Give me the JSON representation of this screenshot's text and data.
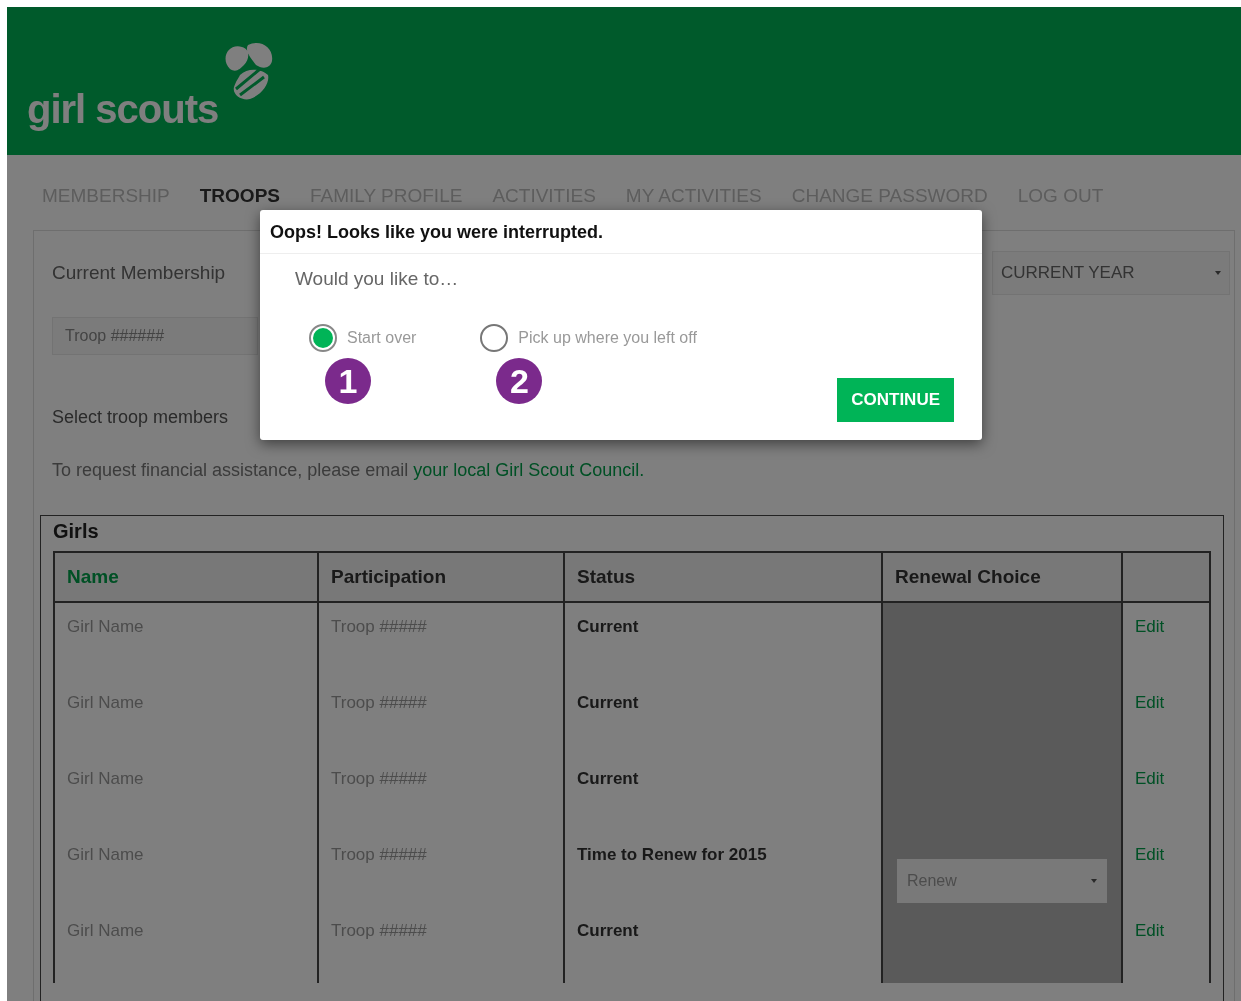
{
  "header": {
    "logo_text": "girl scouts"
  },
  "nav": [
    {
      "label": "MEMBERSHIP",
      "selected": false
    },
    {
      "label": "TROOPS",
      "selected": true
    },
    {
      "label": "FAMILY PROFILE",
      "selected": false
    },
    {
      "label": "ACTIVITIES",
      "selected": false
    },
    {
      "label": "MY ACTIVITIES",
      "selected": false
    },
    {
      "label": "CHANGE PASSWORD",
      "selected": false
    },
    {
      "label": "LOG OUT",
      "selected": false
    }
  ],
  "membership": {
    "label": "Current Membership",
    "year_select": "CURRENT YEAR",
    "troop_select": "Troop ######"
  },
  "instructions": "Select troop members",
  "assistance": {
    "text": "To request financial assistance, please email ",
    "link": "your local Girl Scout Council."
  },
  "girls": {
    "title": "Girls",
    "columns": [
      {
        "label": "Name",
        "link": true
      },
      {
        "label": "Participation",
        "link": false
      },
      {
        "label": "Status",
        "link": false
      },
      {
        "label": "Renewal Choice",
        "link": false
      }
    ],
    "rows": [
      {
        "name": "Girl Name",
        "participation": "Troop #####",
        "status": "Current",
        "action": "Edit"
      },
      {
        "name": "Girl Name",
        "participation": "Troop #####",
        "status": "Current",
        "action": "Edit"
      },
      {
        "name": "Girl Name",
        "participation": "Troop #####",
        "status": "Current",
        "action": "Edit"
      },
      {
        "name": "Girl Name",
        "participation": "Troop #####",
        "status": "Time to Renew for 2015",
        "renewal": "Renew",
        "action": "Edit"
      },
      {
        "name": "Girl Name",
        "participation": "Troop #####",
        "status": "Current",
        "action": "Edit"
      }
    ]
  },
  "dialog": {
    "title": "Oops! Looks like you were interrupted.",
    "prompt": "Would you like to…",
    "options": [
      {
        "label": "Start over",
        "selected": true,
        "marker": "1"
      },
      {
        "label": "Pick up where you left off",
        "selected": false,
        "marker": "2"
      }
    ],
    "button": "CONTINUE"
  }
}
